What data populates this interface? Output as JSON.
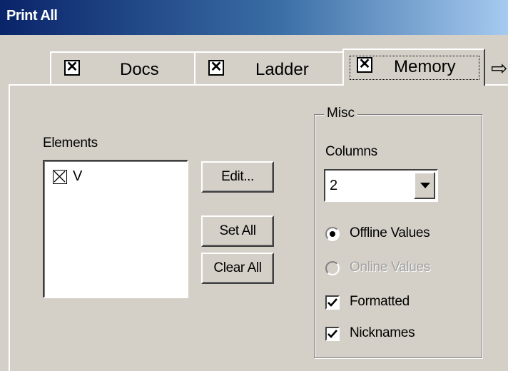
{
  "window": {
    "title": "Print All"
  },
  "tabs": [
    {
      "label": "Docs",
      "checked": true
    },
    {
      "label": "Ladder",
      "checked": true
    },
    {
      "label": "Memory",
      "checked": true,
      "active": true
    }
  ],
  "tab_scroll_icon": "right-arrow-icon",
  "check_mark": "✕",
  "elements": {
    "label": "Elements",
    "items": [
      {
        "label": "V",
        "checked": true
      }
    ],
    "buttons": {
      "edit": "Edit...",
      "set_all": "Set All",
      "clear_all": "Clear All"
    }
  },
  "misc": {
    "legend": "Misc",
    "columns_label": "Columns",
    "columns_value": "2",
    "offline_values": {
      "label": "Offline Values",
      "selected": true,
      "enabled": true
    },
    "online_values": {
      "label": "Online Values",
      "selected": false,
      "enabled": false
    },
    "formatted": {
      "label": "Formatted",
      "checked": true
    },
    "nicknames": {
      "label": "Nicknames",
      "checked": true
    }
  },
  "colors": {
    "titlebar_start": "#0a246a",
    "titlebar_end": "#a6caf0",
    "face": "#d4d0c8"
  }
}
